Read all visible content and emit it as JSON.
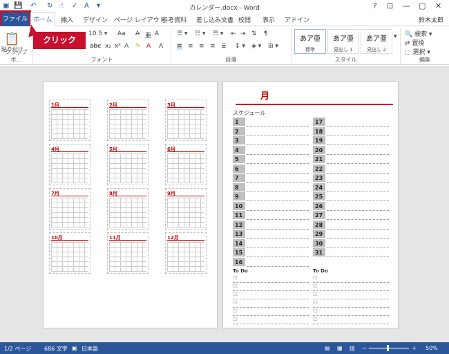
{
  "window": {
    "title": "カレンダー.docx - Word",
    "user": "鈴木太郎"
  },
  "tabs": [
    "ファイル",
    "ホーム",
    "挿入",
    "デザイン",
    "ページ レイアウト",
    "参考資料",
    "差し込み文書",
    "校閲",
    "表示",
    "アドイン"
  ],
  "callout": "クリック",
  "ribbon": {
    "clipboard": {
      "paste": "貼り付け",
      "label": "クリップボ…"
    },
    "font": {
      "label": "フォント",
      "bold": "B",
      "italic": "I",
      "underline": "U",
      "sub": "x₂",
      "sup": "x²",
      "aa": "Aa"
    },
    "paragraph": {
      "label": "段落"
    },
    "styles": {
      "label": "スタイル",
      "items": [
        {
          "sample": "あア亜",
          "name": "標準"
        },
        {
          "sample": "あア亜",
          "name": "見出し 1"
        },
        {
          "sample": "あア亜",
          "name": "見出し 2"
        }
      ]
    },
    "editing": {
      "label": "編集",
      "find": "検索",
      "replace": "置換",
      "select": "選択"
    }
  },
  "left_page": {
    "months": [
      "1月",
      "2月",
      "3月",
      "4月",
      "5月",
      "6月",
      "7月",
      "8月",
      "9月",
      "10月",
      "11月",
      "12月"
    ]
  },
  "right_page": {
    "heading": "月",
    "schedule": "スケジュール",
    "left_days": [
      "1",
      "2",
      "3",
      "4",
      "5",
      "6",
      "7",
      "8",
      "9",
      "10",
      "11",
      "12",
      "13",
      "14",
      "15",
      "16"
    ],
    "right_days": [
      "17",
      "18",
      "19",
      "20",
      "21",
      "22",
      "23",
      "24",
      "25",
      "26",
      "27",
      "28",
      "29",
      "30",
      "31"
    ],
    "todo": "To Do"
  },
  "status": {
    "page": "1/2 ページ",
    "words": "686 文字",
    "lang": "日本語",
    "zoom": "50%"
  }
}
